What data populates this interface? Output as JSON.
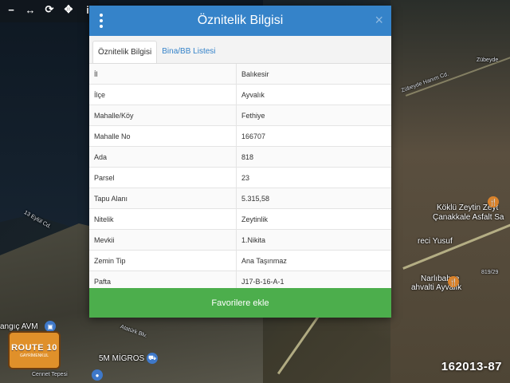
{
  "map": {
    "labels": {
      "zubeyde": "Zübeyde",
      "zubeyde_cd": "Zübeyde Hanım Cd.",
      "koklu": "Köklü Zeytin Zeyt",
      "canakkale": "Çanakkale Asfalt Sa",
      "reci_yusuf": "reci Yusuf",
      "narlibahce": "Narlıbahçe",
      "ahvali": "ahvalti Ayvalık",
      "road_num": "819/29",
      "eylul_cd": "13 Eylül Cd.",
      "avm": "angıç AVM",
      "migros": "5M MİGROS",
      "ataturk": "Atatürk Blv.",
      "cennet": "Cennet Tepesi"
    }
  },
  "toolbar": {
    "icons": [
      "minus-icon",
      "expand-icon",
      "refresh-icon",
      "crosshair-icon",
      "info-icon"
    ],
    "glyphs": [
      "−",
      "↔",
      "⟳",
      "✥",
      "i"
    ]
  },
  "dialog": {
    "title": "Öznitelik Bilgisi",
    "tabs": [
      {
        "label": "Öznitelik Bilgisi",
        "active": true
      },
      {
        "label": "Bina/BB Listesi",
        "active": false
      }
    ],
    "rows": [
      {
        "key": "İl",
        "value": "Balıkesir"
      },
      {
        "key": "İlçe",
        "value": "Ayvalık"
      },
      {
        "key": "Mahalle/Köy",
        "value": "Fethiye"
      },
      {
        "key": "Mahalle No",
        "value": "166707"
      },
      {
        "key": "Ada",
        "value": "818"
      },
      {
        "key": "Parsel",
        "value": "23"
      },
      {
        "key": "Tapu Alanı",
        "value": "5.315,58"
      },
      {
        "key": "Nitelik",
        "value": "Zeytinlik"
      },
      {
        "key": "Mevkii",
        "value": "1.Nikita"
      },
      {
        "key": "Zemin Tip",
        "value": "Ana Taşınmaz"
      },
      {
        "key": "Pafta",
        "value": "J17-B-16-A-1"
      }
    ],
    "button_label": "Favorilere ekle",
    "colors": {
      "header": "#3583c9",
      "button": "#4cae4c"
    }
  },
  "logo": {
    "main": "ROUTE 10",
    "sub": "GAYRİMENKUL"
  },
  "watermark": "162013-87"
}
